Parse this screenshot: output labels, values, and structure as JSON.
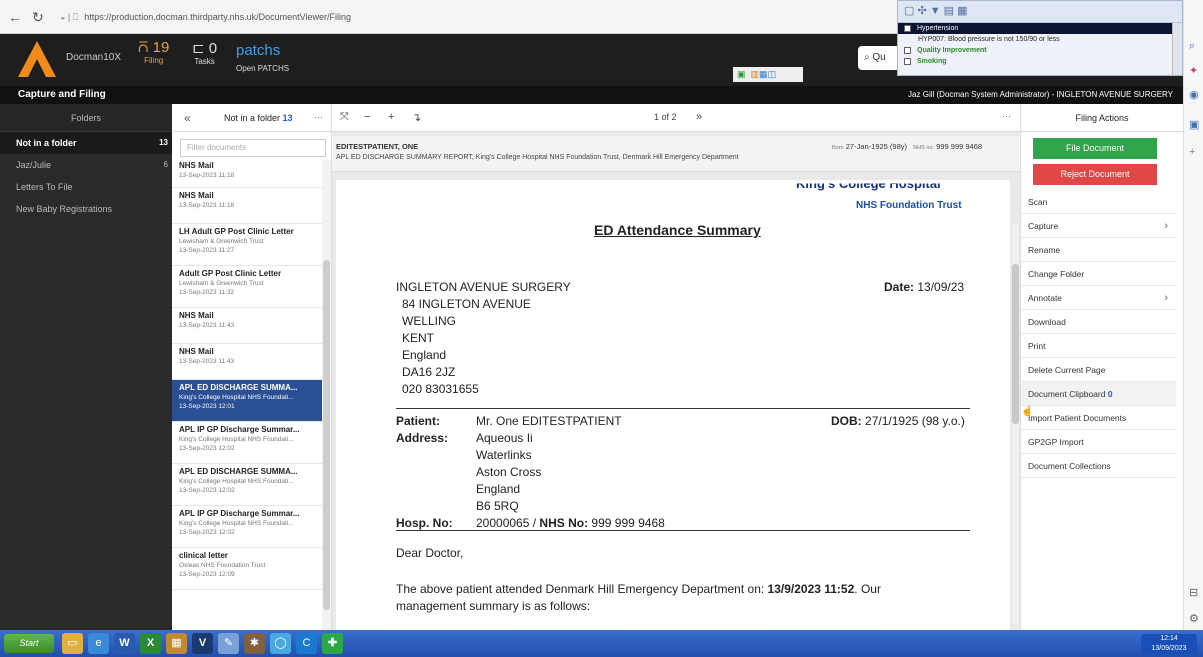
{
  "browser": {
    "url": "https://production.docman.thirdparty.nhs.uk/DocumentViewer/Filing"
  },
  "popup": {
    "rows": [
      "Hypertension",
      "HYP007: Blood pressure is not 150/90 or less",
      "Quality Improvement",
      "Smoking"
    ]
  },
  "header": {
    "brand": "Docman10X",
    "filing_count": "19",
    "filing_label": "Filing",
    "tasks_count": "0",
    "tasks_label": "Tasks",
    "patchs_title": "patchs",
    "patchs_label": "Open PATCHS",
    "quick_label": "Qu"
  },
  "titlebar": {
    "title": "Capture and Filing",
    "user": "Jaz Gill (Docman System Administrator) - INGLETON AVENUE SURGERY"
  },
  "folders": {
    "header": "Folders",
    "items": [
      {
        "label": "Not in a folder",
        "count": "13"
      },
      {
        "label": "Jaz/Julie",
        "count": "6"
      },
      {
        "label": "Letters To File",
        "count": ""
      },
      {
        "label": "New Baby Registrations",
        "count": ""
      }
    ]
  },
  "doclist": {
    "header_label": "Not in a folder",
    "header_count": "13",
    "more": "···",
    "filter_placeholder": "Filter documents",
    "items": [
      {
        "title": "NHS Mail",
        "org": "",
        "date": "13-Sep-2023 11:18"
      },
      {
        "title": "NHS Mail",
        "org": "",
        "date": "13-Sep-2023 11:18"
      },
      {
        "title": "LH Adult GP Post Clinic Letter",
        "org": "Lewisham & Greenwich Trust",
        "date": "13-Sep-2023 11:27"
      },
      {
        "title": "Adult GP Post Clinic Letter",
        "org": "Lewisham & Greenwich Trust",
        "date": "13-Sep-2023 11:32"
      },
      {
        "title": "NHS Mail",
        "org": "",
        "date": "13-Sep-2023 11:43"
      },
      {
        "title": "NHS Mail",
        "org": "",
        "date": "13-Sep-2023 11:43"
      },
      {
        "title": "APL ED DISCHARGE SUMMA...",
        "org": "King's College Hospital NHS Foundati...",
        "date": "13-Sep-2023 12:01"
      },
      {
        "title": "APL IP GP Discharge Summar...",
        "org": "King's College Hospital NHS Foundati...",
        "date": "13-Sep-2023 12:02"
      },
      {
        "title": "APL ED DISCHARGE SUMMA...",
        "org": "King's College Hospital NHS Foundati...",
        "date": "13-Sep-2023 12:02"
      },
      {
        "title": "APL IP GP Discharge Summar...",
        "org": "King's College Hospital NHS Foundati...",
        "date": "13-Sep-2023 12:02"
      },
      {
        "title": "clinical letter",
        "org": "Oxleas NHS Foundation Trust",
        "date": "13-Sep-2023 12:09"
      }
    ]
  },
  "viewer": {
    "page_indicator": "1 of 2",
    "patient_name": "EDITESTPATIENT, ONE",
    "doc_desc": "APL ED DISCHARGE SUMMARY REPORT, King's College Hospital NHS Foundation Trust, Denmark Hill Emergency Department",
    "born_label": "Born",
    "born_value": "27-Jan-1925 (98y)",
    "nhs_label": "NHS no.",
    "nhs_value": "999 999 9468"
  },
  "letter": {
    "hospital_name": "King's College Hospital",
    "trust_name": "NHS Foundation Trust",
    "title": "ED Attendance Summary",
    "address": [
      "INGLETON AVENUE SURGERY",
      "84 INGLETON AVENUE",
      "WELLING",
      "KENT",
      "England",
      "DA16 2JZ",
      "020 83031655"
    ],
    "date_label": "Date:",
    "date_value": "13/09/23",
    "patient_label": "Patient:",
    "patient_value": "Mr. One EDITESTPATIENT",
    "dob_label": "DOB:",
    "dob_value": "27/1/1925 (98 y.o.)",
    "address_label": "Address:",
    "patient_address": [
      "Aqueous Ii",
      "Waterlinks",
      "Aston Cross",
      "England",
      "B6 5RQ"
    ],
    "hosp_no_label": "Hosp. No:",
    "hosp_no_value": "20000065 /",
    "nhs_no_label": "NHS No:",
    "nhs_no_value": "999 999 9468",
    "salutation": "Dear Doctor,",
    "body_1": "The above patient attended Denmark Hill Emergency Department on: ",
    "body_bold": "13/9/2023 11:52",
    "body_2": ". Our",
    "body_3": "management summary is as follows:"
  },
  "actions": {
    "header": "Filing Actions",
    "file_document": "File Document",
    "reject_document": "Reject Document",
    "items": [
      "Scan",
      "Capture",
      "Rename",
      "Change Folder",
      "Annotate",
      "Download",
      "Print",
      "Delete Current Page",
      "Document Clipboard",
      "Import Patient Documents",
      "GP2GP Import",
      "Document Collections"
    ],
    "clipboard_count": "0"
  },
  "colors": {
    "accent_orange": "#e8a33a",
    "patchs_blue": "#3aa0e8",
    "selected_blue": "#2a4f94",
    "file_green": "#2fa44a",
    "reject_red": "#e04848"
  },
  "taskbar": {
    "start": "Start",
    "time": "12:14",
    "date": "13/09/2023"
  }
}
